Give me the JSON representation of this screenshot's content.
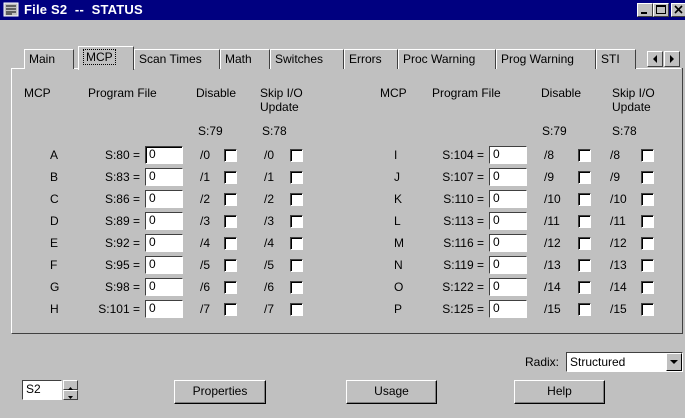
{
  "window": {
    "title": "File S2  --  STATUS",
    "title_icon": "file-icon",
    "controls": [
      "minimize-icon",
      "maximize-icon",
      "close-icon"
    ]
  },
  "tabs": [
    {
      "label": "Main",
      "active": false
    },
    {
      "label": "MCP",
      "active": true
    },
    {
      "label": "Scan Times",
      "active": false
    },
    {
      "label": "Math",
      "active": false
    },
    {
      "label": "Switches",
      "active": false
    },
    {
      "label": "Errors",
      "active": false
    },
    {
      "label": "Proc Warning",
      "active": false
    },
    {
      "label": "Prog Warning",
      "active": false
    },
    {
      "label": "STI",
      "active": false
    }
  ],
  "headers": {
    "mcp": "MCP",
    "program_file": "Program File",
    "disable": "Disable",
    "skip_line1": "Skip I/O",
    "skip_line2": "Update",
    "disable_addr": "S:79",
    "skip_addr": "S:78"
  },
  "left_rows": [
    {
      "mcp": "A",
      "address": "S:80 =",
      "value": "0",
      "disable": "/0",
      "skip": "/0"
    },
    {
      "mcp": "B",
      "address": "S:83 =",
      "value": "0",
      "disable": "/1",
      "skip": "/1"
    },
    {
      "mcp": "C",
      "address": "S:86 =",
      "value": "0",
      "disable": "/2",
      "skip": "/2"
    },
    {
      "mcp": "D",
      "address": "S:89 =",
      "value": "0",
      "disable": "/3",
      "skip": "/3"
    },
    {
      "mcp": "E",
      "address": "S:92 =",
      "value": "0",
      "disable": "/4",
      "skip": "/4"
    },
    {
      "mcp": "F",
      "address": "S:95 =",
      "value": "0",
      "disable": "/5",
      "skip": "/5"
    },
    {
      "mcp": "G",
      "address": "S:98 =",
      "value": "0",
      "disable": "/6",
      "skip": "/6"
    },
    {
      "mcp": "H",
      "address": "S:101 =",
      "value": "0",
      "disable": "/7",
      "skip": "/7"
    }
  ],
  "right_rows": [
    {
      "mcp": "I",
      "address": "S:104 =",
      "value": "0",
      "disable": "/8",
      "skip": "/8"
    },
    {
      "mcp": "J",
      "address": "S:107 =",
      "value": "0",
      "disable": "/9",
      "skip": "/9"
    },
    {
      "mcp": "K",
      "address": "S:110 =",
      "value": "0",
      "disable": "/10",
      "skip": "/10"
    },
    {
      "mcp": "L",
      "address": "S:113 =",
      "value": "0",
      "disable": "/11",
      "skip": "/11"
    },
    {
      "mcp": "M",
      "address": "S:116 =",
      "value": "0",
      "disable": "/12",
      "skip": "/12"
    },
    {
      "mcp": "N",
      "address": "S:119 =",
      "value": "0",
      "disable": "/13",
      "skip": "/13"
    },
    {
      "mcp": "O",
      "address": "S:122 =",
      "value": "0",
      "disable": "/14",
      "skip": "/14"
    },
    {
      "mcp": "P",
      "address": "S:125 =",
      "value": "0",
      "disable": "/15",
      "skip": "/15"
    }
  ],
  "radix": {
    "label": "Radix:",
    "value": "Structured"
  },
  "file_spinner": {
    "value": "S2"
  },
  "buttons": {
    "properties": "Properties",
    "usage": "Usage",
    "help": "Help"
  },
  "colors": {
    "titlebar": "#000080",
    "face": "#c0c0c0"
  }
}
